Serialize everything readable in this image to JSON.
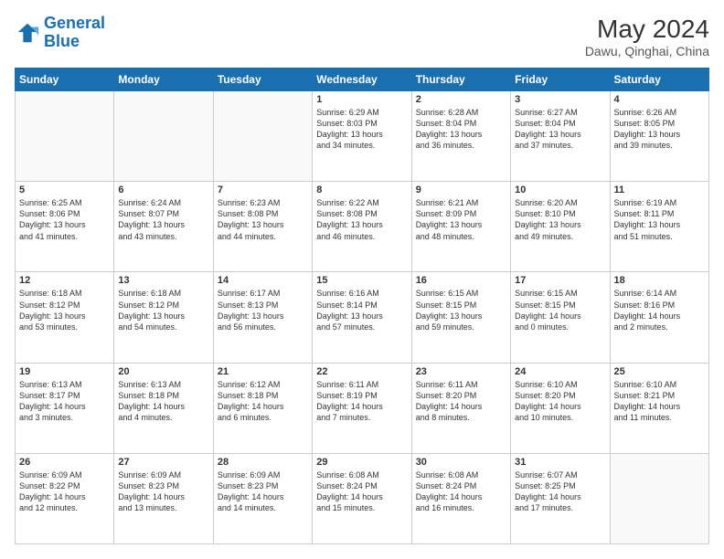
{
  "header": {
    "logo_line1": "General",
    "logo_line2": "Blue",
    "month": "May 2024",
    "location": "Dawu, Qinghai, China"
  },
  "weekdays": [
    "Sunday",
    "Monday",
    "Tuesday",
    "Wednesday",
    "Thursday",
    "Friday",
    "Saturday"
  ],
  "weeks": [
    [
      {
        "day": "",
        "info": ""
      },
      {
        "day": "",
        "info": ""
      },
      {
        "day": "",
        "info": ""
      },
      {
        "day": "1",
        "info": "Sunrise: 6:29 AM\nSunset: 8:03 PM\nDaylight: 13 hours\nand 34 minutes."
      },
      {
        "day": "2",
        "info": "Sunrise: 6:28 AM\nSunset: 8:04 PM\nDaylight: 13 hours\nand 36 minutes."
      },
      {
        "day": "3",
        "info": "Sunrise: 6:27 AM\nSunset: 8:04 PM\nDaylight: 13 hours\nand 37 minutes."
      },
      {
        "day": "4",
        "info": "Sunrise: 6:26 AM\nSunset: 8:05 PM\nDaylight: 13 hours\nand 39 minutes."
      }
    ],
    [
      {
        "day": "5",
        "info": "Sunrise: 6:25 AM\nSunset: 8:06 PM\nDaylight: 13 hours\nand 41 minutes."
      },
      {
        "day": "6",
        "info": "Sunrise: 6:24 AM\nSunset: 8:07 PM\nDaylight: 13 hours\nand 43 minutes."
      },
      {
        "day": "7",
        "info": "Sunrise: 6:23 AM\nSunset: 8:08 PM\nDaylight: 13 hours\nand 44 minutes."
      },
      {
        "day": "8",
        "info": "Sunrise: 6:22 AM\nSunset: 8:08 PM\nDaylight: 13 hours\nand 46 minutes."
      },
      {
        "day": "9",
        "info": "Sunrise: 6:21 AM\nSunset: 8:09 PM\nDaylight: 13 hours\nand 48 minutes."
      },
      {
        "day": "10",
        "info": "Sunrise: 6:20 AM\nSunset: 8:10 PM\nDaylight: 13 hours\nand 49 minutes."
      },
      {
        "day": "11",
        "info": "Sunrise: 6:19 AM\nSunset: 8:11 PM\nDaylight: 13 hours\nand 51 minutes."
      }
    ],
    [
      {
        "day": "12",
        "info": "Sunrise: 6:18 AM\nSunset: 8:12 PM\nDaylight: 13 hours\nand 53 minutes."
      },
      {
        "day": "13",
        "info": "Sunrise: 6:18 AM\nSunset: 8:12 PM\nDaylight: 13 hours\nand 54 minutes."
      },
      {
        "day": "14",
        "info": "Sunrise: 6:17 AM\nSunset: 8:13 PM\nDaylight: 13 hours\nand 56 minutes."
      },
      {
        "day": "15",
        "info": "Sunrise: 6:16 AM\nSunset: 8:14 PM\nDaylight: 13 hours\nand 57 minutes."
      },
      {
        "day": "16",
        "info": "Sunrise: 6:15 AM\nSunset: 8:15 PM\nDaylight: 13 hours\nand 59 minutes."
      },
      {
        "day": "17",
        "info": "Sunrise: 6:15 AM\nSunset: 8:15 PM\nDaylight: 14 hours\nand 0 minutes."
      },
      {
        "day": "18",
        "info": "Sunrise: 6:14 AM\nSunset: 8:16 PM\nDaylight: 14 hours\nand 2 minutes."
      }
    ],
    [
      {
        "day": "19",
        "info": "Sunrise: 6:13 AM\nSunset: 8:17 PM\nDaylight: 14 hours\nand 3 minutes."
      },
      {
        "day": "20",
        "info": "Sunrise: 6:13 AM\nSunset: 8:18 PM\nDaylight: 14 hours\nand 4 minutes."
      },
      {
        "day": "21",
        "info": "Sunrise: 6:12 AM\nSunset: 8:18 PM\nDaylight: 14 hours\nand 6 minutes."
      },
      {
        "day": "22",
        "info": "Sunrise: 6:11 AM\nSunset: 8:19 PM\nDaylight: 14 hours\nand 7 minutes."
      },
      {
        "day": "23",
        "info": "Sunrise: 6:11 AM\nSunset: 8:20 PM\nDaylight: 14 hours\nand 8 minutes."
      },
      {
        "day": "24",
        "info": "Sunrise: 6:10 AM\nSunset: 8:20 PM\nDaylight: 14 hours\nand 10 minutes."
      },
      {
        "day": "25",
        "info": "Sunrise: 6:10 AM\nSunset: 8:21 PM\nDaylight: 14 hours\nand 11 minutes."
      }
    ],
    [
      {
        "day": "26",
        "info": "Sunrise: 6:09 AM\nSunset: 8:22 PM\nDaylight: 14 hours\nand 12 minutes."
      },
      {
        "day": "27",
        "info": "Sunrise: 6:09 AM\nSunset: 8:23 PM\nDaylight: 14 hours\nand 13 minutes."
      },
      {
        "day": "28",
        "info": "Sunrise: 6:09 AM\nSunset: 8:23 PM\nDaylight: 14 hours\nand 14 minutes."
      },
      {
        "day": "29",
        "info": "Sunrise: 6:08 AM\nSunset: 8:24 PM\nDaylight: 14 hours\nand 15 minutes."
      },
      {
        "day": "30",
        "info": "Sunrise: 6:08 AM\nSunset: 8:24 PM\nDaylight: 14 hours\nand 16 minutes."
      },
      {
        "day": "31",
        "info": "Sunrise: 6:07 AM\nSunset: 8:25 PM\nDaylight: 14 hours\nand 17 minutes."
      },
      {
        "day": "",
        "info": ""
      }
    ]
  ]
}
